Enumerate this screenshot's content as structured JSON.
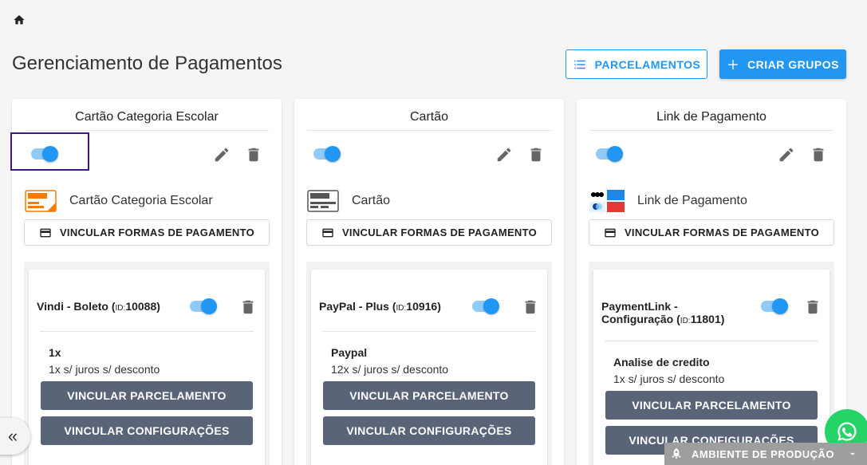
{
  "page": {
    "title": "Gerenciamento de Pagamentos",
    "parcelamentos_label": "PARCELAMENTOS",
    "criar_grupos_label": "CRIAR GRUPOS"
  },
  "colors": {
    "primary": "#2196f3",
    "toggle_track": "#90caf9",
    "dark_button": "#5a6478",
    "focus_outline": "#3d1a78",
    "whatsapp": "#25d366",
    "env_bar": "#9e9e9e"
  },
  "groups": [
    {
      "title": "Cartão Categoria Escolar",
      "enabled": true,
      "method_icon": "credit-orange-card-icon",
      "method_label": "Cartão Categoria Escolar",
      "vincular_formas_label": "VINCULAR FORMAS DE PAGAMENTO",
      "item": {
        "name": "Vindi - Boleto",
        "id_label": "ID:",
        "id": "10088",
        "enabled": true,
        "plan_name": "1x",
        "plan_desc": "1x s/ juros s/ desconto",
        "vincular_parcelamento_label": "VINCULAR PARCELAMENTO",
        "vincular_configuracoes_label": "VINCULAR CONFIGURAÇÕES"
      }
    },
    {
      "title": "Cartão",
      "enabled": true,
      "method_icon": "credit-gray-card-icon",
      "method_label": "Cartão",
      "vincular_formas_label": "VINCULAR FORMAS DE PAGAMENTO",
      "item": {
        "name": "PayPal - Plus",
        "id_label": "ID:",
        "id": "10916",
        "enabled": true,
        "plan_name": "Paypal",
        "plan_desc": "12x s/ juros s/ desconto",
        "vincular_parcelamento_label": "VINCULAR PARCELAMENTO",
        "vincular_configuracoes_label": "VINCULAR CONFIGURAÇÕES"
      }
    },
    {
      "title": "Link de Pagamento",
      "enabled": true,
      "method_icon": "card-brands-icon",
      "method_label": "Link de Pagamento",
      "vincular_formas_label": "VINCULAR FORMAS DE PAGAMENTO",
      "item": {
        "name_line1": "PaymentLink -",
        "name_line2": "Configuração",
        "id_label": "ID:",
        "id": "11801",
        "enabled": true,
        "plan_name": "Analise de credito",
        "plan_desc": "1x s/ juros s/ desconto",
        "vincular_parcelamento_label": "VINCULAR PARCELAMENTO",
        "vincular_configuracoes_label": "VINCULAR CONFIGURAÇÕES"
      }
    }
  ],
  "footer": {
    "collapse_glyph": "«",
    "environment_label": "AMBIENTE DE PRODUÇÃO"
  }
}
